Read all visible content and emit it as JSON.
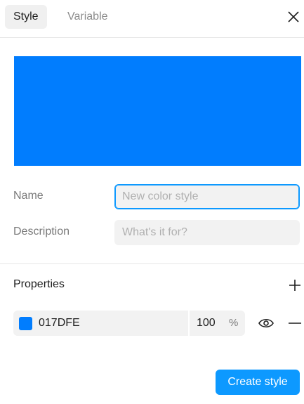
{
  "tabs": [
    {
      "label": "Style",
      "active": true
    },
    {
      "label": "Variable",
      "active": false
    }
  ],
  "icons": {
    "close": "close-icon",
    "add": "plus-icon",
    "visibility": "eye-icon",
    "remove": "minus-icon"
  },
  "swatch": {
    "color": "#017DFE"
  },
  "form": {
    "name_label": "Name",
    "name_value": "",
    "name_placeholder": "New color style",
    "description_label": "Description",
    "description_value": "",
    "description_placeholder": "What's it for?"
  },
  "properties": {
    "title": "Properties",
    "fill": {
      "hex": "017DFE",
      "color": "#017DFE",
      "opacity": "100",
      "opacity_unit": "%"
    }
  },
  "actions": {
    "create_label": "Create style",
    "accent": "#0D99FF"
  }
}
